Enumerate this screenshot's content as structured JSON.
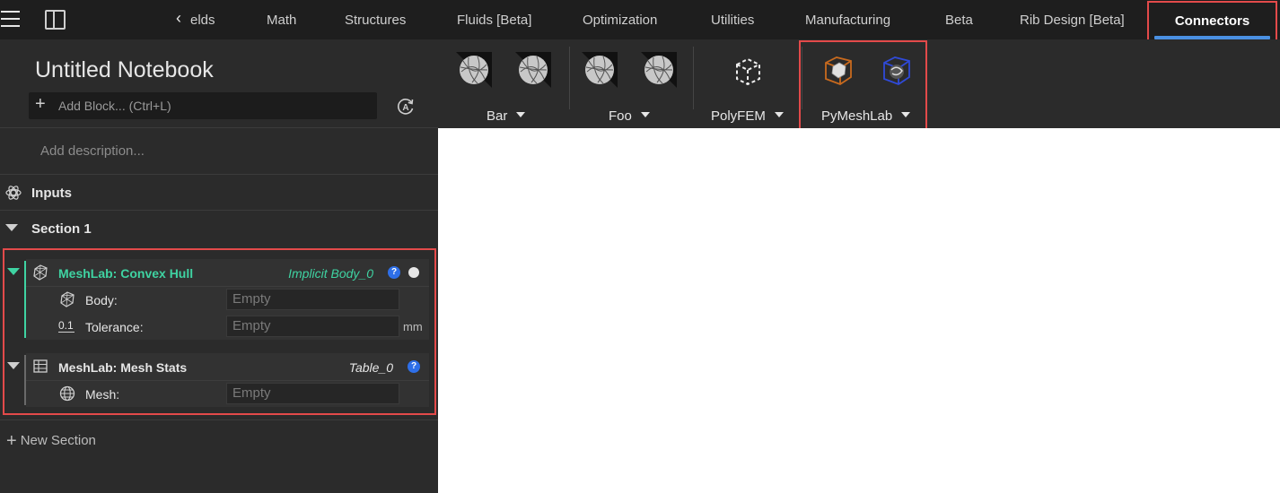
{
  "topbar": {
    "tabs": [
      {
        "label": "elds",
        "partial": true
      },
      {
        "label": "Math"
      },
      {
        "label": "Structures"
      },
      {
        "label": "Fluids [Beta]"
      },
      {
        "label": "Optimization"
      },
      {
        "label": "Utilities"
      },
      {
        "label": "Manufacturing"
      },
      {
        "label": "Beta"
      },
      {
        "label": "Rib Design [Beta]"
      }
    ],
    "active_tab": "Connectors",
    "accent_color": "#4a90e2",
    "highlight_color": "#e34a4a"
  },
  "notebook": {
    "title": "Untitled Notebook",
    "add_block_placeholder": "Add Block... (Ctrl+L)",
    "description_placeholder": "Add description...",
    "inputs_label": "Inputs",
    "section_label": "Section 1",
    "new_section_label": "New Section"
  },
  "blocks": [
    {
      "title": "MeshLab: Convex Hull",
      "output": "Implicit Body_0",
      "title_color": "#3fd3a2",
      "expanded": true,
      "fields": [
        {
          "label": "Body:",
          "value": "Empty",
          "icon": "mesh-icon"
        },
        {
          "label": "Tolerance:",
          "value": "Empty",
          "unit": "mm",
          "icon_text": "0.1"
        }
      ]
    },
    {
      "title": "MeshLab: Mesh Stats",
      "output": "Table_0",
      "title_color": "#e6e6e6",
      "expanded": true,
      "fields": [
        {
          "label": "Mesh:",
          "value": "Empty",
          "icon": "globe-icon"
        }
      ]
    }
  ],
  "ribbon": {
    "groups": [
      {
        "label": "Bar",
        "icons": [
          "sphere-icon",
          "sphere-icon"
        ]
      },
      {
        "label": "Foo",
        "icons": [
          "sphere-icon",
          "sphere-icon"
        ]
      },
      {
        "label": "PolyFEM",
        "icons": [
          "dashed-cube-icon"
        ]
      },
      {
        "label": "PyMeshLab",
        "icons": [
          "orange-cube-icon",
          "blue-cube-icon"
        ]
      }
    ]
  }
}
